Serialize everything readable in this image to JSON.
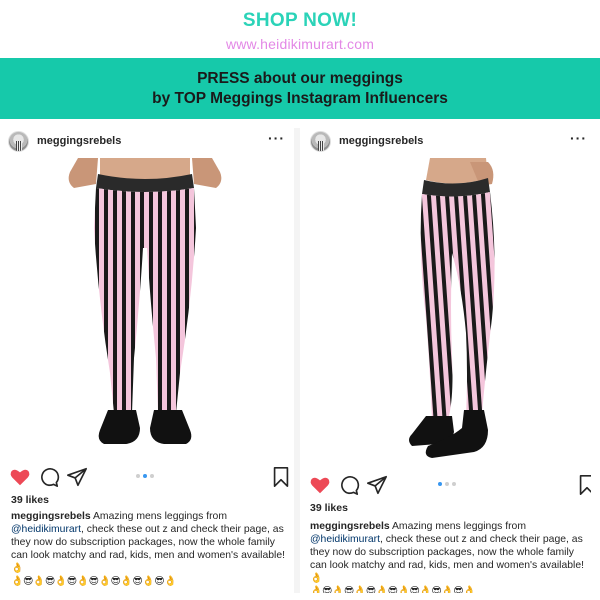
{
  "header": {
    "shop_now": "SHOP NOW!",
    "url": "www.heidikimurart.com"
  },
  "banner": {
    "line1": "PRESS about our meggings",
    "line2": "by TOP Meggings Instagram Influencers"
  },
  "colors": {
    "teal_accent": "#2bd3b8",
    "url_pink": "#e388e6",
    "banner_bg": "#16c9aa",
    "heart_red": "#ed4956",
    "stripe_pink": "#f4c6dc",
    "stripe_black": "#1a1a1a",
    "carousel_active": "#3897f0"
  },
  "posts": [
    {
      "username": "meggingsrebels",
      "more_icon": "···",
      "icons": [
        "heart-icon-filled",
        "comment-icon",
        "share-icon",
        "bookmark-icon"
      ],
      "carousel_active_index": 1,
      "carousel_count": 3,
      "likes": "39 likes",
      "caption_user": "meggingsrebels",
      "caption_text_1": " Amazing mens leggings from ",
      "caption_mention": "@heidikimurart",
      "caption_text_2": ", check these out z and check their page, as they now do subscription packages, now the whole family can look matchy and rad, kids, men and women's available!",
      "emoji_line_1": "👌",
      "emoji_line_2": "👌😎👌😎👌😎👌😎👌😎👌😎👌😎👌"
    },
    {
      "username": "meggingsrebels",
      "more_icon": "···",
      "icons": [
        "heart-icon-filled",
        "comment-icon",
        "share-icon",
        "bookmark-icon"
      ],
      "carousel_active_index": 0,
      "carousel_count": 3,
      "likes": "39 likes",
      "caption_user": "meggingsrebels",
      "caption_text_1": " Amazing mens leggings from ",
      "caption_mention": "@heidikimurart",
      "caption_text_2": ", check these out z and check their page, as they now do subscription packages, now the whole family can look matchy and rad, kids, men and women's available!",
      "emoji_line_1": "👌",
      "emoji_line_2": "👌😎👌😎👌😎👌😎👌😎👌😎👌😎👌"
    }
  ]
}
